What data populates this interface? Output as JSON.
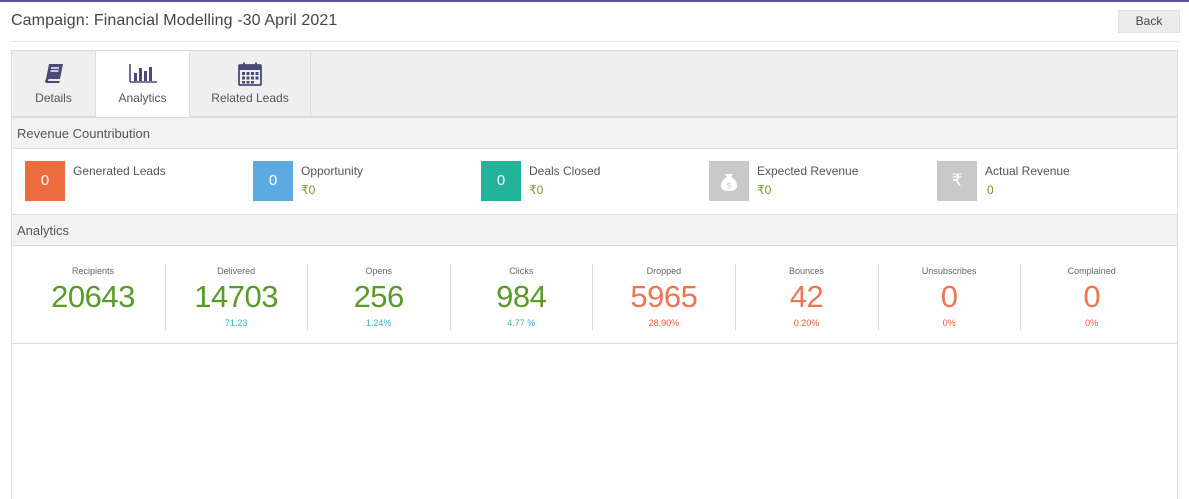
{
  "header": {
    "title": "Campaign: Financial Modelling -30 April 2021",
    "back_label": "Back"
  },
  "tabs": [
    {
      "label": "Details",
      "icon": "book-icon",
      "active": false
    },
    {
      "label": "Analytics",
      "icon": "bar-chart-icon",
      "active": true
    },
    {
      "label": "Related Leads",
      "icon": "calendar-icon",
      "active": false
    }
  ],
  "revenue": {
    "title": "Revenue Countribution",
    "items": [
      {
        "label": "Generated Leads",
        "box": "0",
        "value": "",
        "color": "#ee6a3f"
      },
      {
        "label": "Opportunity",
        "box": "0",
        "value": "₹0",
        "color": "#5daae3"
      },
      {
        "label": "Deals Closed",
        "box": "0",
        "value": "₹0",
        "color": "#22b39b"
      },
      {
        "label": "Expected Revenue",
        "box": "money-bag-icon",
        "value": "₹0",
        "color": "#c9c9c9"
      },
      {
        "label": "Actual Revenue",
        "box": "rupee-icon",
        "value": "0",
        "color": "#c9c9c9"
      }
    ]
  },
  "analytics": {
    "title": "Analytics",
    "stats": [
      {
        "label": "Recipients",
        "value": "20643",
        "sub": "",
        "color": "#5a9a2a",
        "sub_color": "#3bb3c3"
      },
      {
        "label": "Delivered",
        "value": "14703",
        "sub": "71.23",
        "color": "#5a9a2a",
        "sub_color": "#3bb3c3"
      },
      {
        "label": "Opens",
        "value": "256",
        "sub": "1.24%",
        "color": "#5a9a2a",
        "sub_color": "#3bb3c3"
      },
      {
        "label": "Clicks",
        "value": "984",
        "sub": "4.77 %",
        "color": "#5a9a2a",
        "sub_color": "#3bb3c3"
      },
      {
        "label": "Dropped",
        "value": "5965",
        "sub": "28.90%",
        "color": "#ee7454",
        "sub_color": "#e8583a"
      },
      {
        "label": "Bounces",
        "value": "42",
        "sub": "0.20%",
        "color": "#ee7454",
        "sub_color": "#e8583a"
      },
      {
        "label": "Unsubscribes",
        "value": "0",
        "sub": "0%",
        "color": "#ee7454",
        "sub_color": "#e8583a"
      },
      {
        "label": "Complained",
        "value": "0",
        "sub": "0%",
        "color": "#ee7454",
        "sub_color": "#e8583a"
      }
    ]
  }
}
